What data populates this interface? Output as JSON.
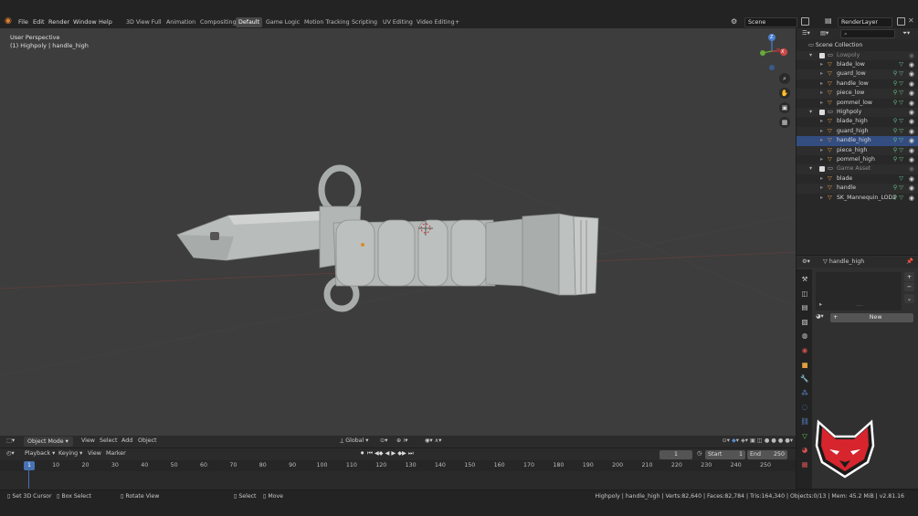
{
  "menu": [
    "File",
    "Edit",
    "Render",
    "Window",
    "Help"
  ],
  "workspaces": [
    "3D View Full",
    "Animation",
    "Compositing",
    "Default",
    "Game Logic",
    "Motion Tracking",
    "Scripting",
    "UV Editing",
    "Video Editing"
  ],
  "active_workspace": "Default",
  "add_workspace": "+",
  "scene": "Scene",
  "render_layer": "RenderLayer",
  "viewport": {
    "perspective": "User Perspective",
    "object_info": "(1) Highpoly | handle_high",
    "mode": "Object Mode",
    "menus": [
      "View",
      "Select",
      "Add",
      "Object"
    ],
    "orientation": "Global",
    "gizmo": {
      "x": "X",
      "y": "Y",
      "z": "Z"
    }
  },
  "outliner": {
    "root": "Scene Collection",
    "rows": [
      {
        "name": "Lowpoly",
        "type": "collection",
        "level": 1,
        "dim": true
      },
      {
        "name": "blade_low",
        "type": "mesh",
        "level": 2
      },
      {
        "name": "guard_low",
        "type": "mesh",
        "level": 2
      },
      {
        "name": "handle_low",
        "type": "mesh",
        "level": 2
      },
      {
        "name": "piece_low",
        "type": "mesh",
        "level": 2
      },
      {
        "name": "pommel_low",
        "type": "mesh",
        "level": 2
      },
      {
        "name": "Highpoly",
        "type": "collection",
        "level": 1
      },
      {
        "name": "blade_high",
        "type": "mesh",
        "level": 2
      },
      {
        "name": "guard_high",
        "type": "mesh",
        "level": 2
      },
      {
        "name": "handle_high",
        "type": "mesh",
        "level": 2,
        "selected": true
      },
      {
        "name": "piece_high",
        "type": "mesh",
        "level": 2
      },
      {
        "name": "pommel_high",
        "type": "mesh",
        "level": 2
      },
      {
        "name": "Game Asset",
        "type": "collection",
        "level": 1,
        "dim": true
      },
      {
        "name": "blade",
        "type": "mesh",
        "level": 2
      },
      {
        "name": "handle",
        "type": "mesh",
        "level": 2
      },
      {
        "name": "SK_Mannequin_LOD2",
        "type": "mesh",
        "level": 2
      }
    ]
  },
  "properties": {
    "object": "handle_high",
    "new_button": "New"
  },
  "timeline": {
    "menus": [
      "Playback",
      "Keying",
      "View",
      "Marker"
    ],
    "current_frame": "1",
    "start_label": "Start",
    "start": "1",
    "end_label": "End",
    "end": "250",
    "ticks": [
      "1",
      "10",
      "20",
      "30",
      "40",
      "50",
      "60",
      "70",
      "80",
      "90",
      "100",
      "110",
      "120",
      "130",
      "140",
      "150",
      "160",
      "170",
      "180",
      "190",
      "200",
      "210",
      "220",
      "230",
      "240",
      "250"
    ]
  },
  "statusbar": {
    "left": [
      "Set 3D Cursor",
      "Box Select",
      "Rotate View",
      "Select",
      "Move"
    ],
    "right": "Highpoly | handle_high | Verts:82,640 | Faces:82,784 | Tris:164,340 | Objects:0/13 | Mem: 45.2 MiB | v2.81.16"
  },
  "colors": {
    "accent": "#4772b3",
    "frame": "#4772b3",
    "logo": "#d6252d"
  }
}
